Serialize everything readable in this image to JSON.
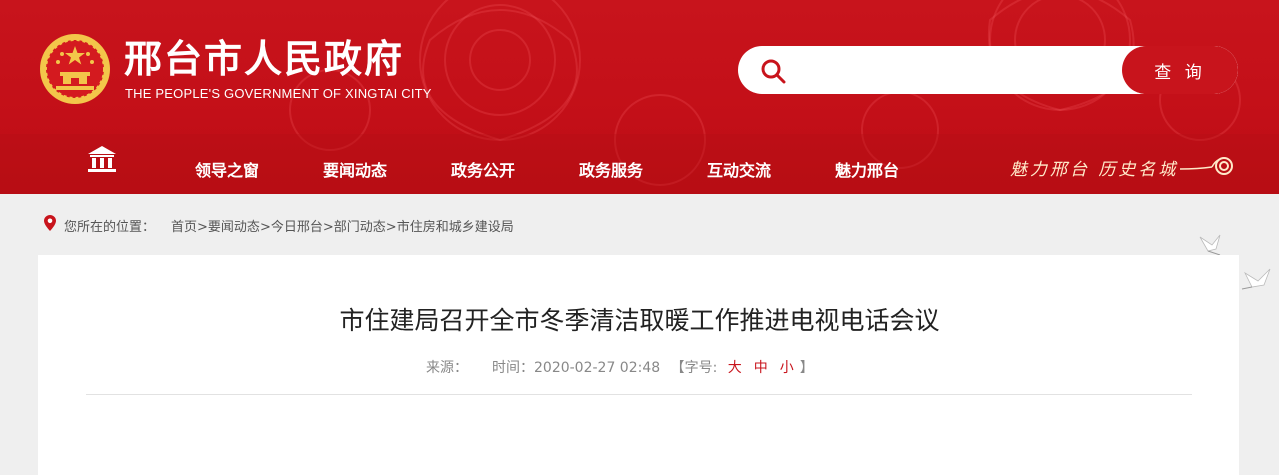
{
  "header": {
    "site_title": "邢台市人民政府",
    "site_subtitle": "THE PEOPLE'S GOVERNMENT OF XINGTAI CITY",
    "search": {
      "placeholder": "",
      "value": "",
      "button_label": "查 询"
    },
    "nav": [
      "领导之窗",
      "要闻动态",
      "政务公开",
      "政务服务",
      "互动交流",
      "魅力邢台"
    ],
    "slogan": "魅力邢台 历史名城"
  },
  "breadcrumb": {
    "label": "您所在的位置：",
    "items": [
      "首页",
      "要闻动态",
      "今日邢台",
      "部门动态",
      "市住房和城乡建设局"
    ],
    "separator": ">"
  },
  "article": {
    "title": "市住建局召开全市冬季清洁取暖工作推进电视电话会议",
    "source_label": "来源：",
    "time_label": "时间：",
    "time": "2020-02-27 02:48",
    "font_size_label": "【字号:",
    "font_sizes": [
      "大",
      "中",
      "小"
    ],
    "font_size_close": "】"
  },
  "colors": {
    "brand_red": "#c8141c",
    "gold": "#f3c64a",
    "page_bg": "#efefef"
  },
  "icons": {
    "home": "home-icon",
    "search": "search-icon",
    "location": "location-pin-icon",
    "emblem": "national-emblem-icon"
  }
}
